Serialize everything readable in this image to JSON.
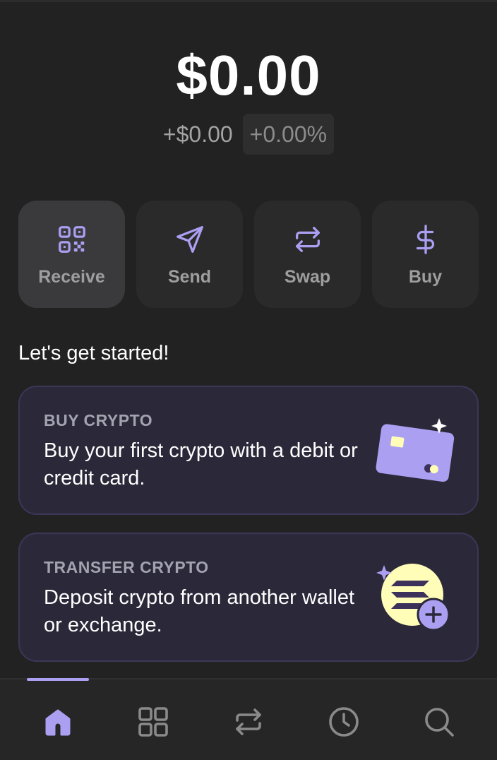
{
  "balance": {
    "total": "$0.00",
    "change_amount": "+$0.00",
    "change_percent": "+0.00%"
  },
  "actions": [
    {
      "label": "Receive",
      "icon": "qr-code-icon"
    },
    {
      "label": "Send",
      "icon": "send-icon"
    },
    {
      "label": "Swap",
      "icon": "swap-icon"
    },
    {
      "label": "Buy",
      "icon": "dollar-icon"
    }
  ],
  "onboarding": {
    "title": "Let's get started!",
    "cards": [
      {
        "title": "BUY CRYPTO",
        "description": "Buy your first crypto with a debit or credit card.",
        "icon": "credit-card-icon"
      },
      {
        "title": "TRANSFER CRYPTO",
        "description": "Deposit crypto from another wallet or exchange.",
        "icon": "deposit-coin-icon"
      }
    ]
  },
  "tabbar": {
    "active": "home",
    "tabs": [
      "home-icon",
      "grid-icon",
      "swap-icon",
      "history-icon",
      "search-icon"
    ]
  },
  "colors": {
    "background": "#222222",
    "accent": "#ab9ff2",
    "card_background": "#2b2939",
    "muted_text": "#9e9e9e"
  }
}
